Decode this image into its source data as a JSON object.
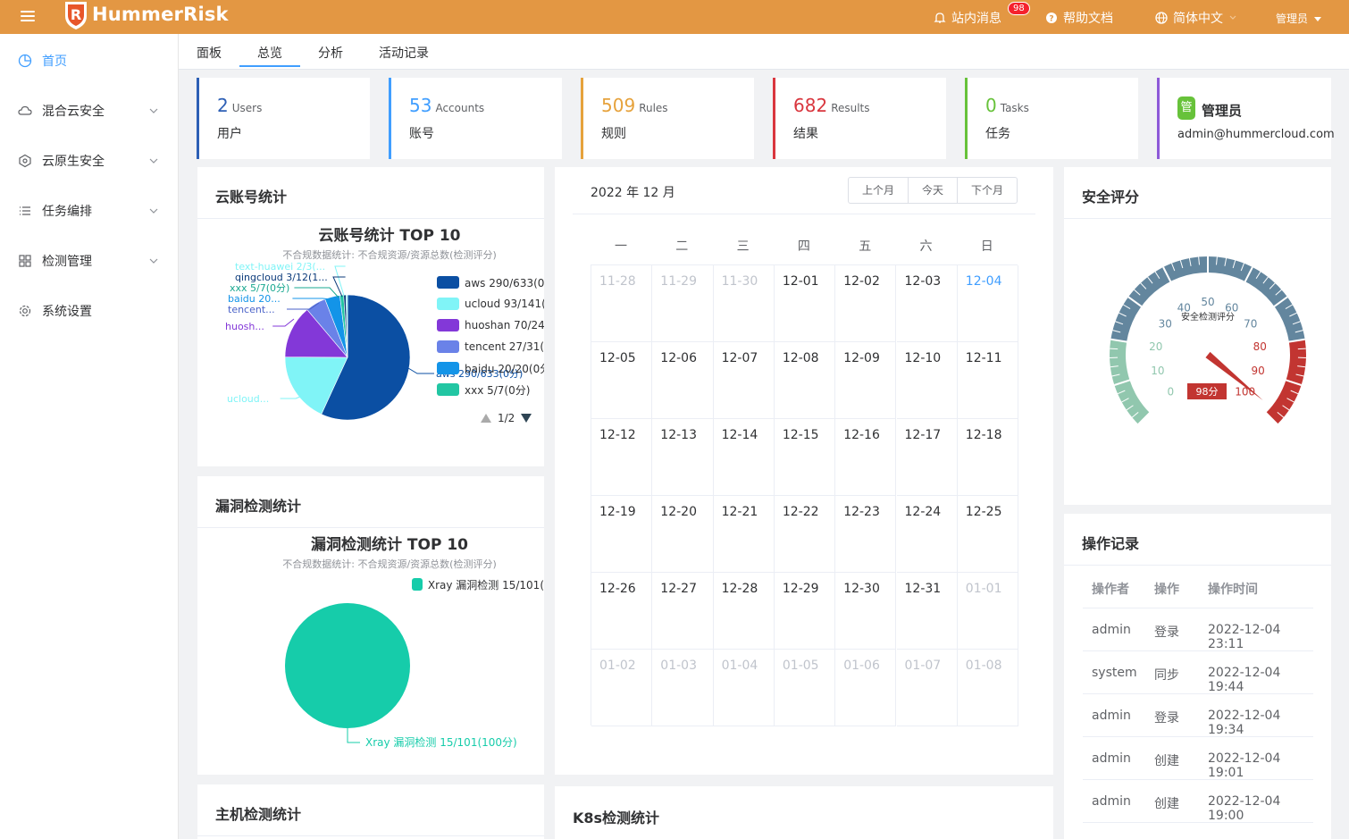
{
  "header": {
    "brand": "HummerRisk",
    "messages_label": "站内消息",
    "messages_badge": "98",
    "help_label": "帮助文档",
    "lang_label": "简体中文",
    "user_label": "管理员"
  },
  "sidebar": {
    "items": [
      {
        "label": "首页",
        "icon": "pie-chart-icon"
      },
      {
        "label": "混合云安全",
        "icon": "cloud-icon"
      },
      {
        "label": "云原生安全",
        "icon": "cloud-native-icon"
      },
      {
        "label": "任务编排",
        "icon": "list-icon"
      },
      {
        "label": "检测管理",
        "icon": "grid-icon"
      },
      {
        "label": "系统设置",
        "icon": "gear-icon"
      }
    ]
  },
  "tabs": [
    "面板",
    "总览",
    "分析",
    "活动记录"
  ],
  "stats": [
    {
      "num": "2",
      "unit": "Users",
      "cn": "用户",
      "color": "#2d5fb5"
    },
    {
      "num": "53",
      "unit": "Accounts",
      "cn": "账号",
      "color": "#409eff"
    },
    {
      "num": "509",
      "unit": "Rules",
      "cn": "规则",
      "color": "#e6a23c"
    },
    {
      "num": "682",
      "unit": "Results",
      "cn": "结果",
      "color": "#d9363e"
    },
    {
      "num": "0",
      "unit": "Tasks",
      "cn": "任务",
      "color": "#67c23a"
    }
  ],
  "user_card": {
    "avatar": "管",
    "name": "管理员",
    "email": "admin@hummercloud.com",
    "color": "#8e5ad8"
  },
  "cloud_card": {
    "header": "云账号统计",
    "chart_title": "云账号统计 TOP 10",
    "subtitle": "不合规数据统计: 不合规资源/资源总数(检测评分)",
    "legend": [
      {
        "label": "aws 290/633(0分",
        "color": "#0b4fa3"
      },
      {
        "label": "ucloud 93/141(8",
        "color": "#80f4f7"
      },
      {
        "label": "huoshan 70/245",
        "color": "#8338d8"
      },
      {
        "label": "tencent 27/31(0",
        "color": "#6a82e8"
      },
      {
        "label": "baidu 20/20(0分",
        "color": "#1394e8"
      },
      {
        "label": "xxx 5/7(0分)",
        "color": "#22c6a3"
      },
      {
        "label": "qingcloud 3/12(1",
        "color": "#0b4fa3"
      }
    ],
    "pager": "1/2",
    "pie_labels": [
      {
        "text": "text-huawei 2/3(...",
        "color": "#80f4f7"
      },
      {
        "text": "qingcloud 3/12(1...",
        "color": "#0b3a7a"
      },
      {
        "text": "xxx 5/7(0分)",
        "color": "#1aa890"
      },
      {
        "text": "baidu 20...",
        "color": "#1394e8"
      },
      {
        "text": "tencent...",
        "color": "#4a62c8"
      },
      {
        "text": "huosh...",
        "color": "#8338d8"
      },
      {
        "text": "ucloud...",
        "color": "#80f4f7"
      },
      {
        "text": "aws 290/633(0分)",
        "color": "#0b4fa3"
      }
    ]
  },
  "vuln_card": {
    "header": "漏洞检测统计",
    "chart_title": "漏洞检测统计 TOP 10",
    "subtitle": "不合规数据统计: 不合规资源/资源总数(检测评分)",
    "legend": "Xray 漏洞检测 15/101(",
    "pie_label": "Xray 漏洞检测 15/101(100分)",
    "color": "#16ccaa"
  },
  "host_card": {
    "header": "主机检测统计"
  },
  "k8s_card": {
    "header": "K8s检测统计"
  },
  "calendar": {
    "title": "2022 年 12 月",
    "buttons": [
      "上个月",
      "今天",
      "下个月"
    ],
    "weekdays": [
      "一",
      "二",
      "三",
      "四",
      "五",
      "六",
      "日"
    ],
    "weeks": [
      [
        {
          "d": "11-28",
          "o": true
        },
        {
          "d": "11-29",
          "o": true
        },
        {
          "d": "11-30",
          "o": true
        },
        {
          "d": "12-01"
        },
        {
          "d": "12-02"
        },
        {
          "d": "12-03"
        },
        {
          "d": "12-04",
          "t": true
        }
      ],
      [
        {
          "d": "12-05"
        },
        {
          "d": "12-06"
        },
        {
          "d": "12-07"
        },
        {
          "d": "12-08"
        },
        {
          "d": "12-09"
        },
        {
          "d": "12-10"
        },
        {
          "d": "12-11"
        }
      ],
      [
        {
          "d": "12-12"
        },
        {
          "d": "12-13"
        },
        {
          "d": "12-14"
        },
        {
          "d": "12-15"
        },
        {
          "d": "12-16"
        },
        {
          "d": "12-17"
        },
        {
          "d": "12-18"
        }
      ],
      [
        {
          "d": "12-19"
        },
        {
          "d": "12-20"
        },
        {
          "d": "12-21"
        },
        {
          "d": "12-22"
        },
        {
          "d": "12-23"
        },
        {
          "d": "12-24"
        },
        {
          "d": "12-25"
        }
      ],
      [
        {
          "d": "12-26"
        },
        {
          "d": "12-27"
        },
        {
          "d": "12-28"
        },
        {
          "d": "12-29"
        },
        {
          "d": "12-30"
        },
        {
          "d": "12-31"
        },
        {
          "d": "01-01",
          "o": true
        }
      ],
      [
        {
          "d": "01-02",
          "o": true
        },
        {
          "d": "01-03",
          "o": true
        },
        {
          "d": "01-04",
          "o": true
        },
        {
          "d": "01-05",
          "o": true
        },
        {
          "d": "01-06",
          "o": true
        },
        {
          "d": "01-07",
          "o": true
        },
        {
          "d": "01-08",
          "o": true
        }
      ]
    ]
  },
  "security": {
    "header": "安全评分",
    "gauge_title": "安全检测评分",
    "value_label": "98分",
    "value": 98,
    "ticks": [
      "0",
      "10",
      "20",
      "30",
      "40",
      "50",
      "60",
      "70",
      "80",
      "90",
      "100"
    ]
  },
  "oplog": {
    "header": "操作记录",
    "columns": [
      "操作者",
      "操作",
      "操作时间"
    ],
    "rows": [
      {
        "user": "admin",
        "op": "登录",
        "time": "2022-12-04 23:11"
      },
      {
        "user": "system",
        "op": "同步",
        "time": "2022-12-04 19:44"
      },
      {
        "user": "admin",
        "op": "登录",
        "time": "2022-12-04 19:34"
      },
      {
        "user": "admin",
        "op": "创建",
        "time": "2022-12-04 19:01"
      },
      {
        "user": "admin",
        "op": "创建",
        "time": "2022-12-04 19:00"
      }
    ]
  },
  "chart_data": [
    {
      "type": "pie",
      "title": "云账号统计 TOP 10",
      "subtitle": "不合规数据统计: 不合规资源/资源总数(检测评分)",
      "categories": [
        "aws",
        "ucloud",
        "huoshan",
        "tencent",
        "baidu",
        "xxx",
        "qingcloud",
        "text-huawei"
      ],
      "values": [
        290,
        93,
        70,
        27,
        20,
        5,
        3,
        2
      ]
    },
    {
      "type": "pie",
      "title": "漏洞检测统计 TOP 10",
      "subtitle": "不合规数据统计: 不合规资源/资源总数(检测评分)",
      "categories": [
        "Xray 漏洞检测"
      ],
      "values": [
        15
      ]
    }
  ]
}
